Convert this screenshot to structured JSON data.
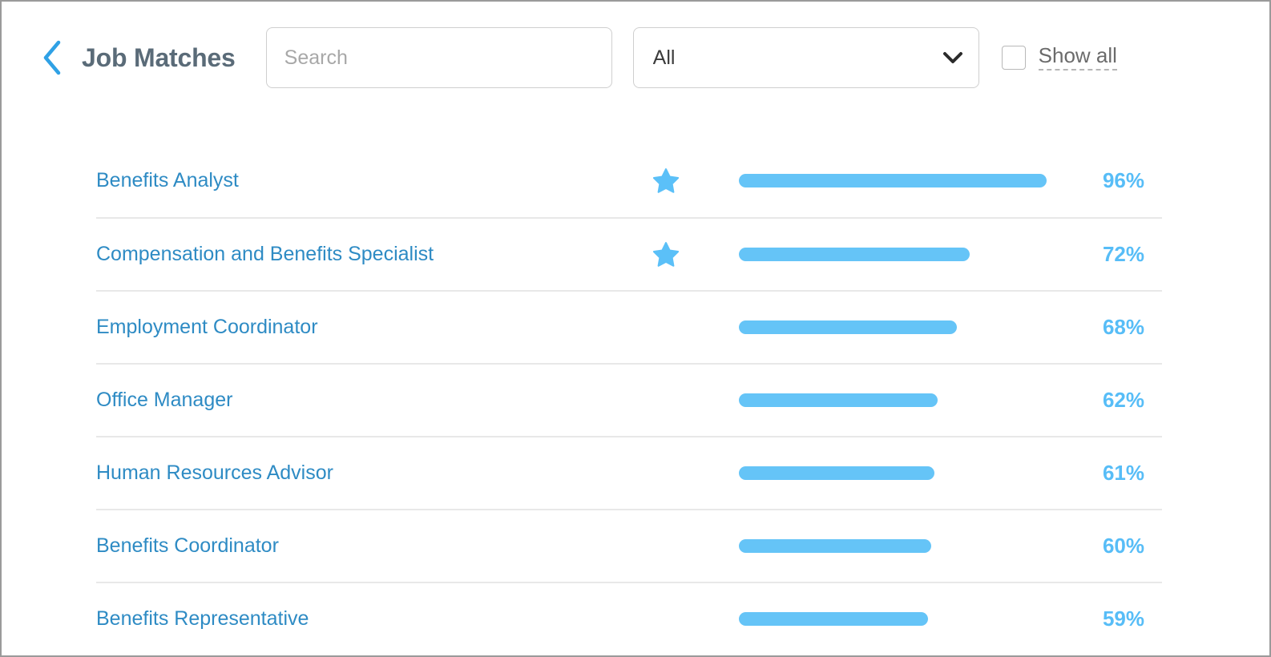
{
  "window": {
    "border_color": "#9a9a9a",
    "background": "#ffffff"
  },
  "colors": {
    "title": "#5a6b78",
    "job_link": "#2e8bc4",
    "accent_light_blue": "#65c4f7",
    "percent_text": "#57bdf7",
    "divider": "#e8e8e8",
    "field_border": "#cfcfcf",
    "muted_text": "#6b6b6b",
    "placeholder": "#a8a8a8",
    "back_chevron": "#2fa1e5"
  },
  "header": {
    "back_icon": "chevron-left-icon",
    "title": "Job Matches",
    "search": {
      "value": "",
      "placeholder": "Search"
    },
    "filter": {
      "selected": "All",
      "options": [
        "All"
      ],
      "chevron_icon": "chevron-down-icon"
    },
    "show_all": {
      "label": "Show all",
      "checked": false
    }
  },
  "list": {
    "bar_max_width": 400,
    "rows": [
      {
        "title": "Benefits Analyst",
        "starred": true,
        "percent": 96,
        "percent_label": "96%"
      },
      {
        "title": "Compensation and Benefits Specialist",
        "starred": true,
        "percent": 72,
        "percent_label": "72%"
      },
      {
        "title": "Employment Coordinator",
        "starred": false,
        "percent": 68,
        "percent_label": "68%"
      },
      {
        "title": "Office Manager",
        "starred": false,
        "percent": 62,
        "percent_label": "62%"
      },
      {
        "title": "Human Resources Advisor",
        "starred": false,
        "percent": 61,
        "percent_label": "61%"
      },
      {
        "title": "Benefits Coordinator",
        "starred": false,
        "percent": 60,
        "percent_label": "60%"
      },
      {
        "title": "Benefits Representative",
        "starred": false,
        "percent": 59,
        "percent_label": "59%"
      }
    ]
  }
}
